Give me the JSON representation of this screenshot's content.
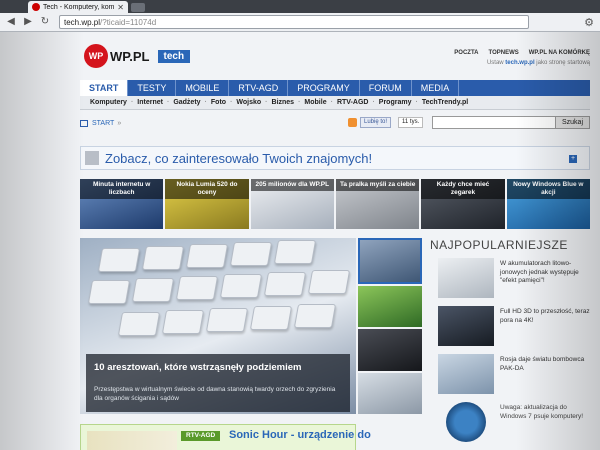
{
  "browser": {
    "tab_title": "Tech - Komputery, komó",
    "tab_close": "✕",
    "url_host": "tech.wp.pl",
    "url_path": "/?ticaid=11074d",
    "back_icon": "back-arrow-icon",
    "forward_icon": "forward-arrow-icon",
    "reload_icon": "reload-icon",
    "menu_icon": "wrench-icon"
  },
  "header": {
    "logo_text": "WP.PL",
    "logo_mark": "WP",
    "section_badge": "tech",
    "toplinks": [
      "POCZTA",
      "TOPNEWS",
      "WP.PL NA KOMÓRKĘ"
    ],
    "tagline_prefix": "Ustaw",
    "tagline_link": "tech.wp.pl",
    "tagline_suffix": "jako stronę startową"
  },
  "main_nav": {
    "items": [
      "START",
      "TESTY",
      "MOBILE",
      "RTV-AGD",
      "PROGRAMY",
      "FORUM",
      "MEDIA"
    ],
    "active": "START"
  },
  "sub_nav": {
    "items": [
      "Komputery",
      "Internet",
      "Gadżety",
      "Foto",
      "Wojsko",
      "Biznes",
      "Mobile",
      "RTV-AGD",
      "Programy",
      "TechTrendy.pl"
    ]
  },
  "crumbs": {
    "start": "START",
    "arrow": "»",
    "like_label": "Lubię to!",
    "like_count": "11 tys.",
    "search_button": "Szukaj"
  },
  "friends_box": {
    "text": "Zobacz, co zainteresowało Twoich znajomych!",
    "plus": "+"
  },
  "thumbnails": [
    {
      "caption": "Minuta internetu w liczbach",
      "color": "#3b5f9a"
    },
    {
      "caption": "Nokia Lumia 520 do oceny",
      "color": "#d9c23a"
    },
    {
      "caption": "205 milionów dla WP.PL",
      "color": "#c9cfd8"
    },
    {
      "caption": "Ta pralka myśli za ciebie",
      "color": "#a9acb1"
    },
    {
      "caption": "Każdy chce mieć zegarek",
      "color": "#3a3f48"
    },
    {
      "caption": "Nowy Windows Blue w akcji",
      "color": "#2e86c8"
    }
  ],
  "hero": {
    "title": "10 aresztowań, które wstrząsnęły podziemiem",
    "description": "Przestępstwa w wirtualnym świecie od dawna stanowią twardy orzech do zgryzienia dla organów ścigania i sądów"
  },
  "side_thumbs": [
    "#5e7796",
    "#4a8a3a",
    "#2d2f35",
    "#b7c2cc"
  ],
  "popular": {
    "title": "NAJPOPULARNIEJSZE",
    "items": [
      {
        "text": "W akumulatorach litowo-jonowych jednak występuje \"efekt pamięci\"!",
        "color": "#cfd5dc"
      },
      {
        "text": "Full HD 3D to przeszłość, teraz pora na 4K!",
        "color": "#2f3744"
      },
      {
        "text": "Rosja daje światu bombowca PAK-DA",
        "color": "#9fb3c8"
      },
      {
        "text": "Uwaga: aktualizacja do Windows 7 psuje komputery!",
        "color": "#3c82c4"
      }
    ]
  },
  "bottom_card": {
    "badge": "RTV-AGD",
    "title": "Sonic Hour - urządzenie do"
  }
}
